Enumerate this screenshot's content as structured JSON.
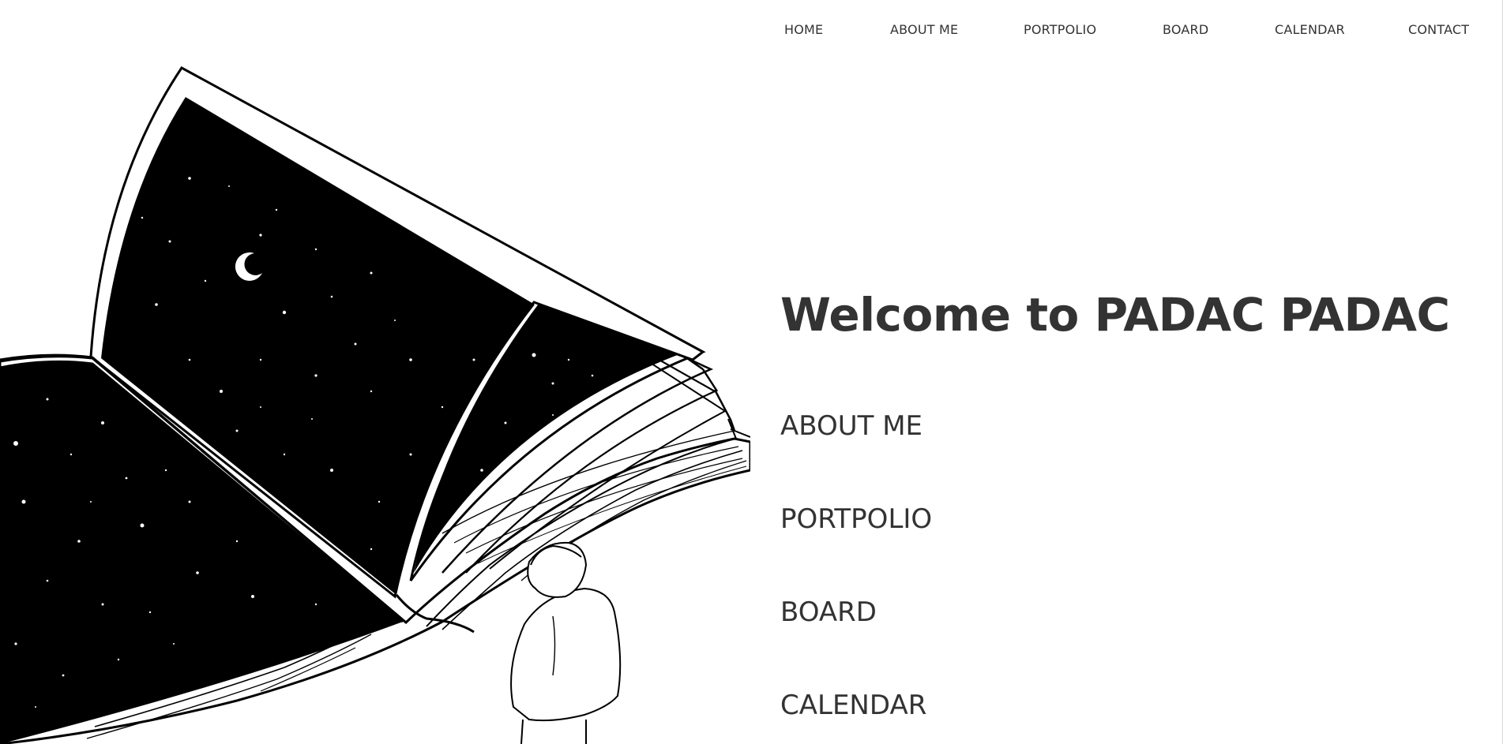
{
  "nav": {
    "items": [
      {
        "label": "HOME"
      },
      {
        "label": "ABOUT ME"
      },
      {
        "label": "PORTPOLIO"
      },
      {
        "label": "BOARD"
      },
      {
        "label": "CALENDAR"
      },
      {
        "label": "CONTACT"
      }
    ]
  },
  "hero": {
    "title": "Welcome to PADAC PADAC",
    "sections": [
      {
        "label": "ABOUT ME"
      },
      {
        "label": "PORTPOLIO"
      },
      {
        "label": "BOARD"
      },
      {
        "label": "CALENDAR"
      }
    ],
    "illustration": {
      "icon": "open-book-starry-sky-with-person-illustration",
      "colors": {
        "ink": "#000000",
        "paper": "#ffffff"
      }
    }
  },
  "colors": {
    "text": "#333333",
    "background": "#ffffff"
  }
}
